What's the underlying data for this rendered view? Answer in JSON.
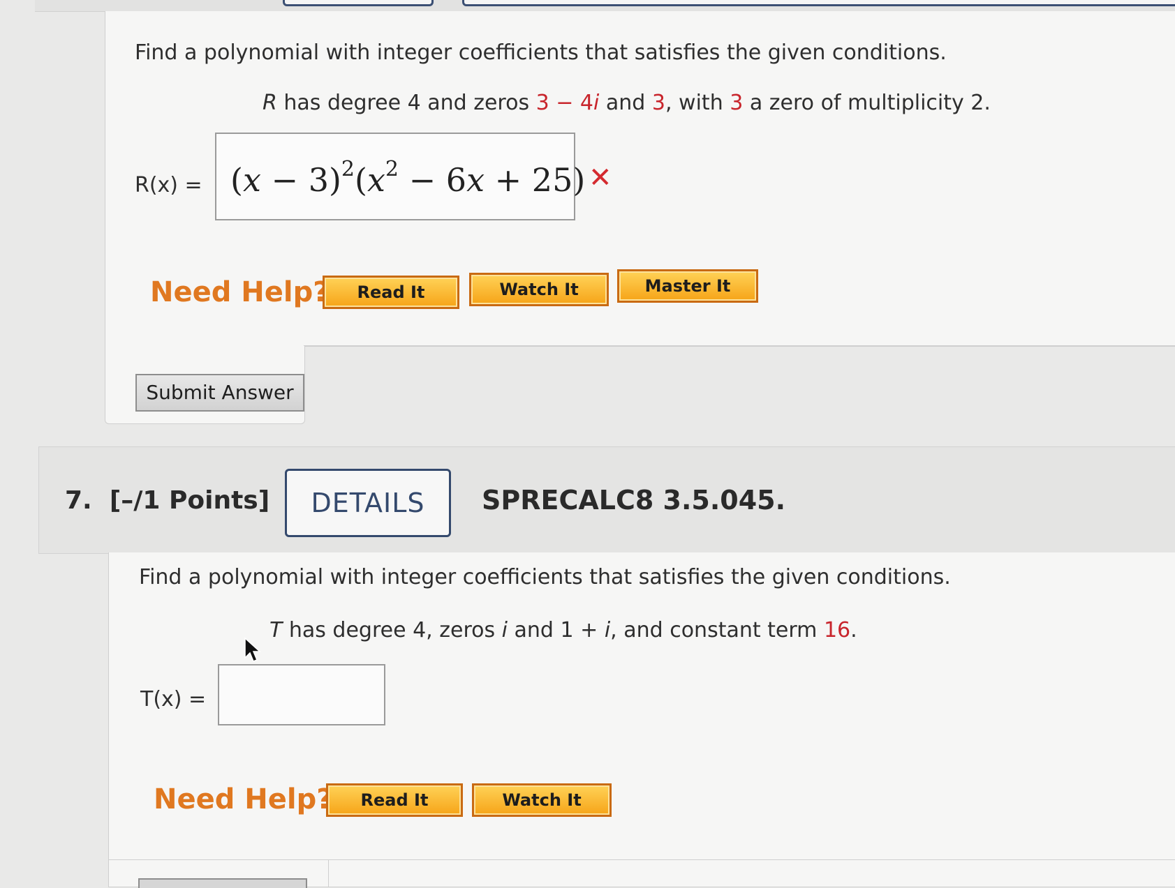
{
  "question6": {
    "prompt": "Find a polynomial with integer coefficients that satisfies the given conditions.",
    "condition": {
      "p1": "R",
      "p2": " has degree 4 and zeros ",
      "z1": "3 − 4",
      "z1i": "i",
      "p3": " and ",
      "z2": "3",
      "p4": ", with ",
      "z3": "3",
      "p5": " a zero of multiplicity 2."
    },
    "function_label": "R(x) =",
    "answer": {
      "x1": "x",
      "minus3": " − 3)",
      "exp1": "2",
      "x2": "x",
      "exp2": "2",
      "rest": " − 6",
      "x3": "x",
      "tail": " + 25",
      "open1": "(",
      "open2": "(",
      "close2": ")"
    },
    "status_icon": "incorrect-x-icon",
    "need_help_label": "Need Help?",
    "help_buttons": [
      "Read It",
      "Watch It",
      "Master It"
    ],
    "submit_label": "Submit Answer"
  },
  "question7": {
    "number": "7.",
    "points": "[–/1 Points]",
    "details_label": "DETAILS",
    "code": "SPRECALC8 3.5.045.",
    "prompt": "Find a polynomial with integer coefficients that satisfies the given conditions.",
    "condition": {
      "p1": "T",
      "p2": " has degree 4, zeros ",
      "i1": "i",
      "p3": " and 1 + ",
      "i2": "i",
      "p4": ", and constant term ",
      "c": "16",
      "p5": "."
    },
    "function_label": "T(x) =",
    "answer_value": "",
    "need_help_label": "Need Help?",
    "help_buttons": [
      "Read It",
      "Watch It"
    ]
  },
  "colors": {
    "accent_red": "#c8252c",
    "need_help_orange": "#e07820",
    "details_navy": "#34496d",
    "button_gold": "#f6a418"
  }
}
